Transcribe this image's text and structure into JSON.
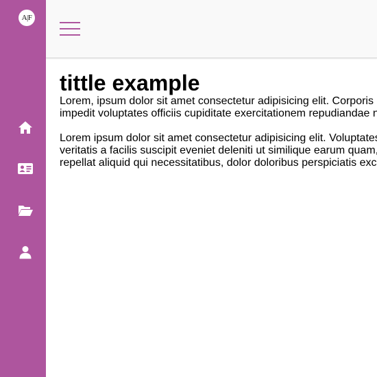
{
  "brand": {
    "logo_text": "A|F",
    "accent_color": "#ae559e"
  },
  "sidebar": {
    "items": [
      {
        "icon": "home-icon"
      },
      {
        "icon": "id-card-icon"
      },
      {
        "icon": "folder-open-icon"
      },
      {
        "icon": "user-icon"
      }
    ]
  },
  "header": {
    "menu_icon": "hamburger-menu-icon"
  },
  "main": {
    "title": "tittle example",
    "paragraph1": {
      "line1": "Lorem, ipsum dolor sit amet consectetur adipisicing elit. Corporis",
      "line2": "impedit voluptates officiis cupiditate exercitationem repudiandae n"
    },
    "paragraph2": {
      "line1": "Lorem ipsum dolor sit amet consectetur adipisicing elit. Voluptates",
      "line2": "veritatis a facilis suscipit eveniet deleniti ut similique earum quam,",
      "line3": "repellat aliquid qui necessitatibus, dolor doloribus perspiciatis exc"
    }
  }
}
